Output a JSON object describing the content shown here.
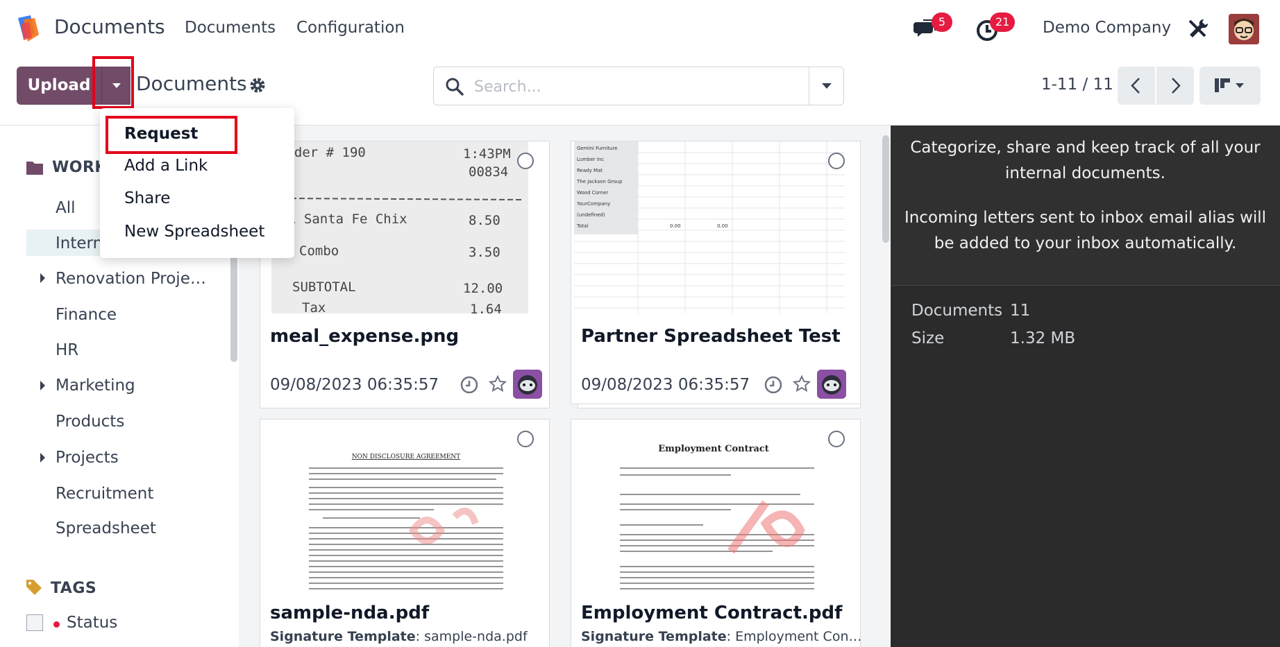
{
  "topnav": {
    "app_name": "Documents",
    "menu": [
      "Documents",
      "Configuration"
    ],
    "messages_count": "5",
    "activities_count": "21",
    "company": "Demo Company"
  },
  "control": {
    "upload_label": "Upload",
    "breadcrumb": "Documents",
    "search_placeholder": "Search...",
    "pager": "1-11 / 11"
  },
  "dropdown": {
    "items": [
      "Request",
      "Add a Link",
      "Share",
      "New Spreadsheet"
    ]
  },
  "sidebar": {
    "workspace_title": "WORK",
    "items": [
      "All",
      "Intern",
      "Renovation Proje…",
      "Finance",
      "HR",
      "Marketing",
      "Products",
      "Projects",
      "Recruitment",
      "Spreadsheet"
    ],
    "tags_title": "TAGS",
    "tag_item": "Status"
  },
  "cards": [
    {
      "title": "meal_expense.png",
      "date": "09/08/2023 06:35:57",
      "receipt": {
        "order": "Order # 190",
        "time": "1:43PM",
        "code": "00834",
        "line1": "1  Santa Fe Chix",
        "v1": "8.50",
        "line2": "Combo",
        "v2": "3.50",
        "subtotal": "SUBTOTAL",
        "vsub": "12.00",
        "tax": "Tax",
        "vtax": "1.64"
      }
    },
    {
      "title": "Partner Spreadsheet Test",
      "date": "09/08/2023 06:35:57",
      "sheet_rows": [
        "Gemini Furniture",
        "Lumber Inc",
        "Ready Mat",
        "The Jackson Group",
        "Wood Corner",
        "YourCompany",
        "(undefined)",
        "Total"
      ],
      "sheet_vals": [
        "0.00",
        "0.00"
      ]
    },
    {
      "title": "sample-nda.pdf",
      "sub_label": "Signature Template",
      "sub_value": ": sample-nda.pdf",
      "doc_heading": "NON DISCLOSURE AGREEMENT"
    },
    {
      "title": "Employment Contract.pdf",
      "sub_label": "Signature Template",
      "sub_value": ": Employment Con…",
      "doc_heading": "Employment Contract"
    }
  ],
  "info": {
    "text1": "Categorize, share and keep track of all your internal documents.",
    "text2": "Incoming letters sent to inbox email alias will be added to your inbox automatically.",
    "documents_label": "Documents",
    "documents_value": "11",
    "size_label": "Size",
    "size_value": "1.32 MB"
  },
  "colors": {
    "brand": "#714b67",
    "badge": "#e51b41",
    "highlight": "#e3001b"
  }
}
